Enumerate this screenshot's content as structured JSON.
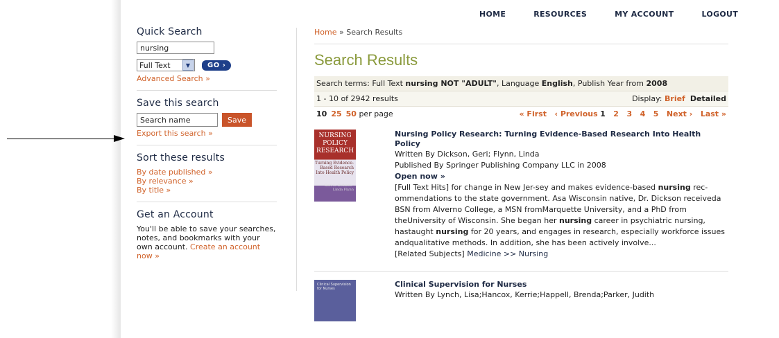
{
  "nav": [
    "HOME",
    "RESOURCES",
    "MY ACCOUNT",
    "LOGOUT"
  ],
  "sidebar": {
    "quick_search_heading": "Quick Search",
    "search_value": "nursing",
    "search_type": "Full Text",
    "go_label": "GO",
    "advanced_link": "Advanced Search »",
    "save_heading": "Save this search",
    "save_name_value": "Search name",
    "save_button": "Save",
    "export_link": "Export this search »",
    "sort_heading": "Sort these results",
    "sort_options": [
      "By date published »",
      "By relevance »",
      "By title »"
    ],
    "account_heading": "Get an Account",
    "account_text": "You'll be able to save your searches, notes, and bookmarks with your own account.",
    "account_link": "Create an account now »"
  },
  "main": {
    "breadcrumb_home": "Home",
    "breadcrumb_sep": " » ",
    "breadcrumb_current": "Search Results",
    "title": "Search Results",
    "terms_prefix": "Search terms: Full Text ",
    "terms_query": "nursing NOT \"ADULT\"",
    "terms_lang_prefix": ", Language ",
    "terms_lang": "English",
    "terms_year_prefix": ", Publish Year from ",
    "terms_year": "2008",
    "result_count": "1 - 10 of 2942 results",
    "display_label": "Display: ",
    "display_brief": "Brief",
    "display_detailed": "Detailed",
    "per_page_current": "10",
    "per_page_options": [
      "25",
      "50"
    ],
    "per_page_suffix": "per page",
    "pager": {
      "first": "« First",
      "prev": "‹ Previous",
      "current": "1",
      "pages": [
        "2",
        "3",
        "4",
        "5"
      ],
      "next": "Next ›",
      "last": "Last »"
    }
  },
  "results": [
    {
      "title": "Nursing Policy Research: Turning Evidence-Based Research Into Health Policy",
      "author": "Written By Dickson, Geri; Flynn, Linda",
      "publisher": "Published By Springer Publishing Company LLC in 2008",
      "open": "Open now »",
      "thumb_title1": "NURSING",
      "thumb_title2": "POLICY",
      "thumb_title3": "RESEARCH",
      "thumb_sub": "Turning Evidence-Based Research Into Health Policy",
      "thumb_authors": "Geri L. Dickson · Linda Flynn",
      "hit_1": "[Full Text Hits] for change in New Jer-sey and makes evidence-based ",
      "hit_bold1": "nursing",
      "hit_2": " rec-ommendations to the state government. Asa Wisconsin native, Dr. Dickson receiveda BSN from Alverno College, a MSN fromMarquette University, and a PhD from theUniversity of Wisconsin. She began her ",
      "hit_bold2": "nursing",
      "hit_3": " career in psychiatric nursing, hastaught ",
      "hit_bold3": "nursing",
      "hit_4": " for 20 years, and engages in research, especially workforce issues andqualitative methods. In addition, she has been actively involve...",
      "related_prefix": "[Related Subjects] ",
      "related": "Medicine >> Nursing"
    },
    {
      "title": "Clinical Supervision for Nurses",
      "author": "Written By Lynch, Lisa;Hancox, Kerrie;Happell, Brenda;Parker, Judith",
      "thumb_title1": "Clinical Supervision for Nurses"
    }
  ],
  "colors": {
    "accent": "#d0622a",
    "olive": "#8a9a3c",
    "navy": "#1e2a44",
    "go": "#1e3f8a"
  }
}
